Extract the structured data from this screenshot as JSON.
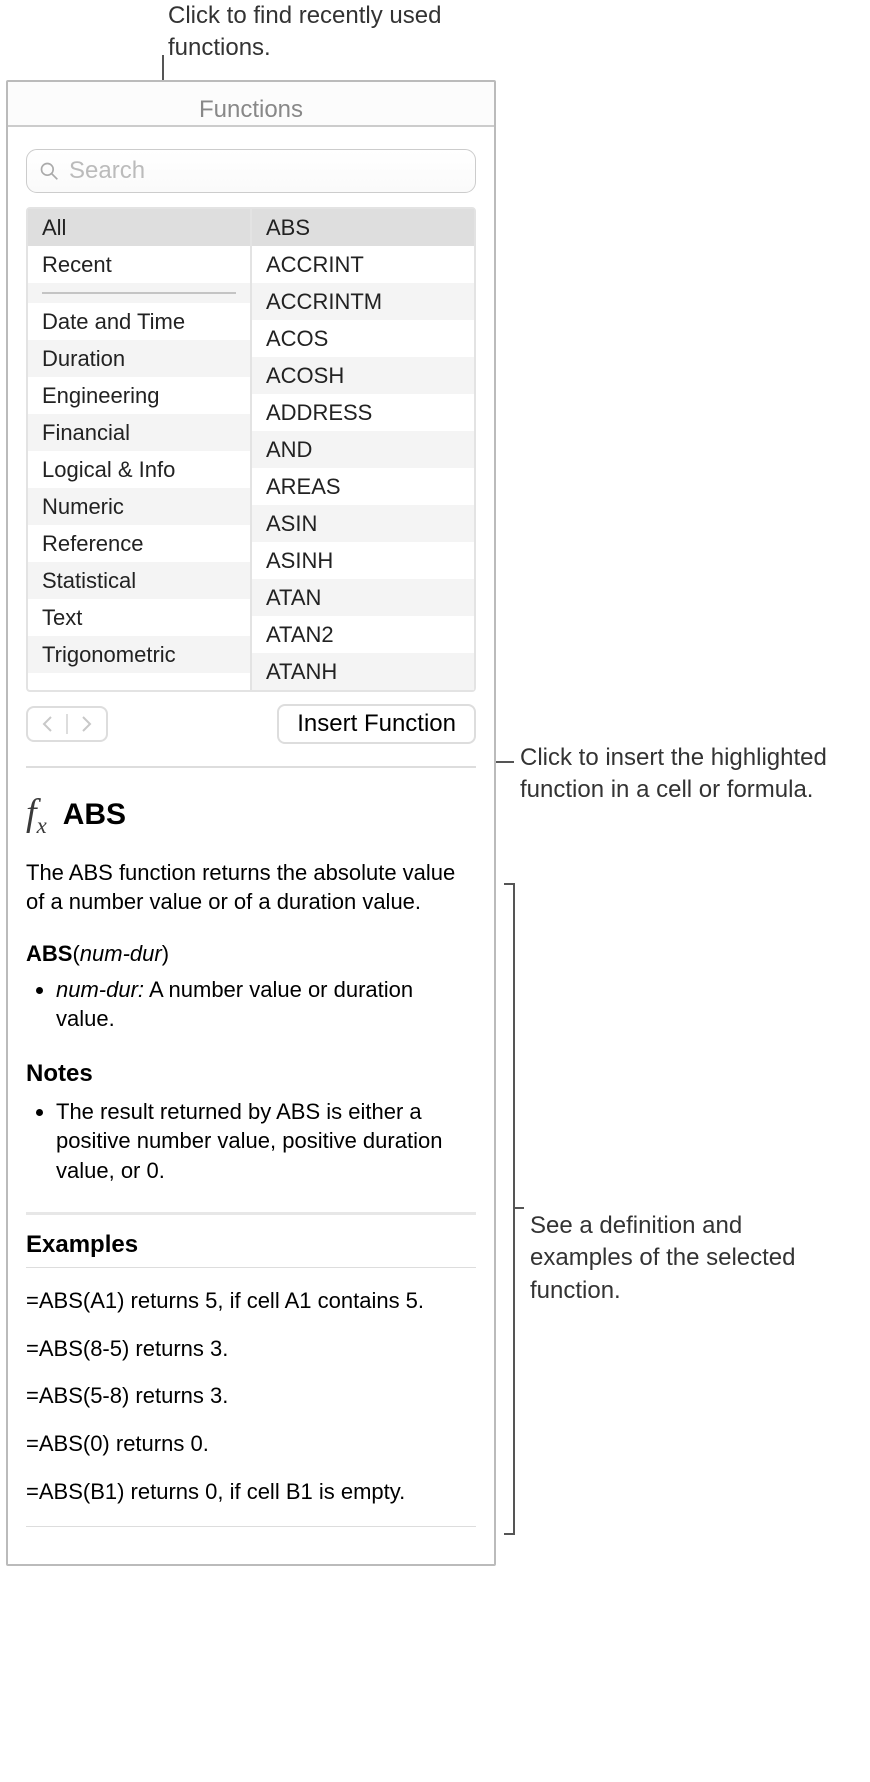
{
  "callouts": {
    "top": "Click to find recently used functions.",
    "insert": "Click to insert the highlighted function in a cell or formula.",
    "help": "See a definition and examples of the selected function."
  },
  "panel": {
    "title": "Functions",
    "search_placeholder": "Search"
  },
  "categories": [
    "All",
    "Recent",
    "Date and Time",
    "Duration",
    "Engineering",
    "Financial",
    "Logical & Info",
    "Numeric",
    "Reference",
    "Statistical",
    "Text",
    "Trigonometric"
  ],
  "functions": [
    "ABS",
    "ACCRINT",
    "ACCRINTM",
    "ACOS",
    "ACOSH",
    "ADDRESS",
    "AND",
    "AREAS",
    "ASIN",
    "ASINH",
    "ATAN",
    "ATAN2",
    "ATANH"
  ],
  "selected_category_index": 0,
  "selected_function_index": 0,
  "insert_button": "Insert Function",
  "help": {
    "function_name": "ABS",
    "description": "The ABS function returns the absolute value of a number value or of a duration value.",
    "syntax_func": "ABS",
    "syntax_params": "num-dur",
    "params": [
      {
        "name": "num-dur:",
        "desc": "A number value or duration value."
      }
    ],
    "notes_title": "Notes",
    "notes": [
      "The result returned by ABS is either a positive number value, positive duration value, or 0."
    ],
    "examples_title": "Examples",
    "examples": [
      "=ABS(A1) returns 5, if cell A1 contains 5.",
      "=ABS(8-5) returns 3.",
      "=ABS(5-8) returns 3.",
      "=ABS(0) returns 0.",
      "=ABS(B1) returns 0, if cell B1 is empty."
    ]
  }
}
